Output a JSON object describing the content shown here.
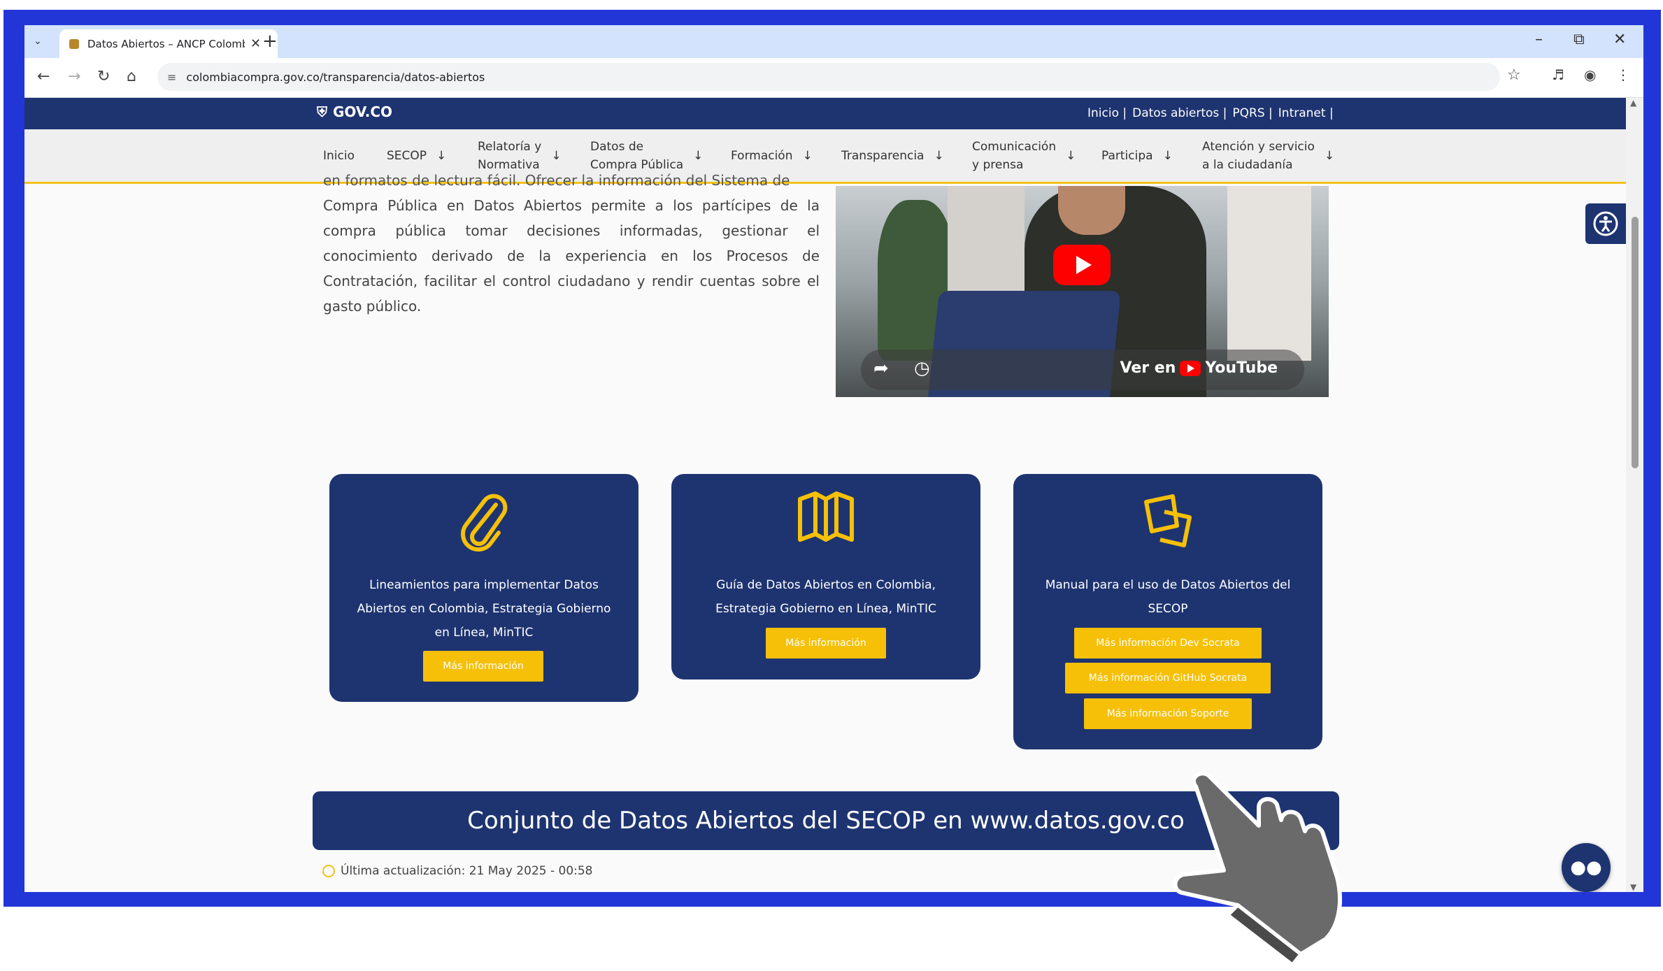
{
  "browser": {
    "tab_title": "Datos Abiertos – ANCP Colombi",
    "new_tab": "+",
    "url": "colombiacompra.gov.co/transparencia/datos-abiertos"
  },
  "gov_bar": {
    "logo": "GOV.CO",
    "links": [
      "Inicio |",
      "Datos abiertos |",
      "PQRS |",
      "Intranet |"
    ]
  },
  "main_nav": [
    {
      "label": "Inicio",
      "has_arrow": false
    },
    {
      "label": "SECOP",
      "has_arrow": true
    },
    {
      "label": "Relatoría y\nNormativa",
      "has_arrow": true
    },
    {
      "label": "Datos de\nCompra Pública",
      "has_arrow": true
    },
    {
      "label": "Formación",
      "has_arrow": true
    },
    {
      "label": "Transparencia",
      "has_arrow": true
    },
    {
      "label": "Comunicación\ny prensa",
      "has_arrow": true
    },
    {
      "label": "Participa",
      "has_arrow": true
    },
    {
      "label": "Atención y servicio\na la ciudadanía",
      "has_arrow": true
    }
  ],
  "intro": {
    "cut_line": "en formatos de lectura fácil. Ofrecer la información del Sistema de",
    "text": "Compra Pública en Datos Abiertos permite a los partícipes de la compra pública tomar decisiones informadas, gestionar el conocimiento derivado de la experiencia en los Procesos de Contratación, facilitar el control ciudadano y rendir cuentas sobre el gasto público."
  },
  "video": {
    "watch_on": "Ver en",
    "platform": "YouTube"
  },
  "cards": [
    {
      "icon": "paperclip-icon",
      "text": "Lineamientos para implementar Datos Abiertos en Colombia, Estrategia Gobierno en Línea, MinTIC",
      "buttons": [
        "Más información"
      ]
    },
    {
      "icon": "map-icon",
      "text": "Guía de Datos Abiertos en Colombia, Estrategia Gobierno en Línea, MinTIC",
      "buttons": [
        "Más información"
      ]
    },
    {
      "icon": "documents-icon",
      "text": "Manual para el uso de Datos Abiertos del SECOP",
      "buttons": [
        "Más información Dev Socrata",
        "Más información GitHub Socrata",
        "Más información Soporte"
      ]
    }
  ],
  "banner": "Conjunto de Datos Abiertos del SECOP en www.datos.gov.co",
  "updated": "Última actualización: 21 May 2025 - 00:58",
  "colors": {
    "frame": "#2236d8",
    "navy": "#1e3471",
    "yellow": "#f6c008"
  }
}
